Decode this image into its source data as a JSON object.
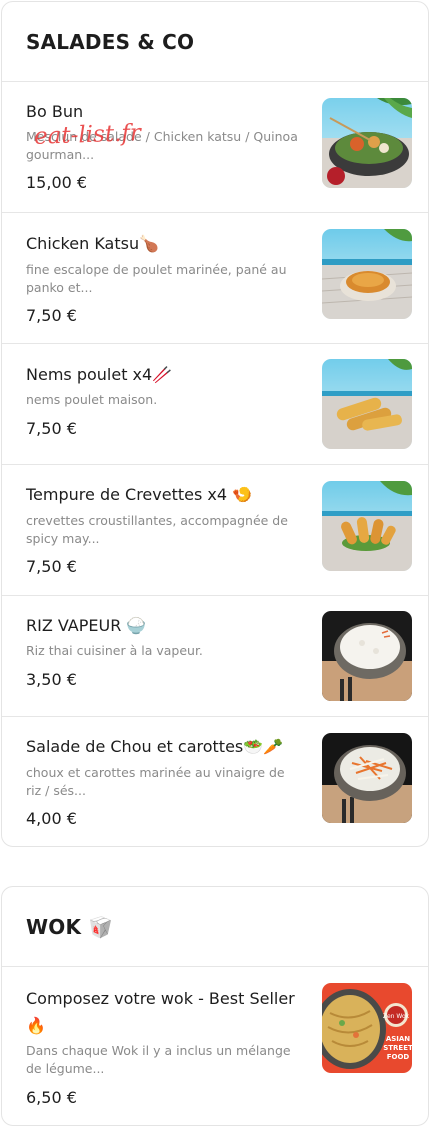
{
  "watermark": "eat-list.fr",
  "sections": [
    {
      "title": "SALADES & CO",
      "items": [
        {
          "name": "Bo Bun",
          "description": "Mesclun de salade / Chicken katsu / Quinoa gourman...",
          "price": "15,00 €",
          "image": "bo-bun-bowl-photo"
        },
        {
          "name": "Chicken Katsu🍗",
          "description": "fine escalope de poulet marinée, pané au panko et...",
          "price": "7,50 €",
          "image": "chicken-katsu-photo"
        },
        {
          "name": "Nems poulet x4🥢",
          "description": "nems poulet maison.",
          "price": "7,50 €",
          "image": "nems-photo"
        },
        {
          "name": "Tempure de Crevettes x4 🍤",
          "description": "crevettes croustillantes, accompagnée de spicy may...",
          "price": "7,50 €",
          "image": "tempura-shrimp-photo"
        },
        {
          "name": "RIZ VAPEUR 🍚",
          "description": "Riz thai cuisiner à la vapeur.",
          "price": "3,50 €",
          "image": "steamed-rice-photo"
        },
        {
          "name": "Salade de Chou et carottes🥗🥕",
          "description": "choux et carottes marinée au vinaigre de riz / sés...",
          "price": "4,00 €",
          "image": "cabbage-carrot-salad-photo"
        }
      ]
    },
    {
      "title": "WOK 🥡",
      "items": [
        {
          "name": "Composez votre wok - Best Seller 🔥",
          "description": "Dans chaque Wok il y a inclus un mélange de légume...",
          "price": "6,50 €",
          "image": "wok-noodles-photo",
          "logo_text": "ASIAN STREET FOOD"
        }
      ]
    }
  ],
  "colors": {
    "watermark": "#e63232",
    "text": "#1e1e1e",
    "muted": "#8a8a8a",
    "border": "#e4e4e4"
  }
}
